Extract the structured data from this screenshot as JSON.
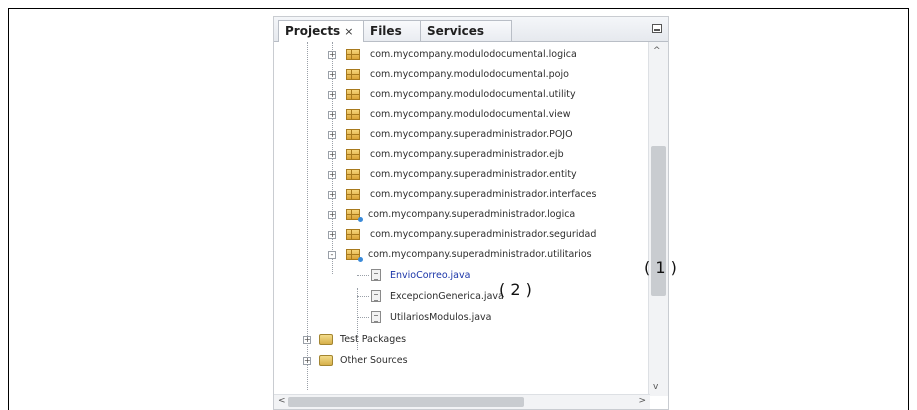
{
  "tabs": [
    {
      "label": "Projects",
      "close": "×",
      "active": true
    },
    {
      "label": "Files",
      "active": false
    },
    {
      "label": "Services",
      "active": false
    }
  ],
  "tree": {
    "packages": [
      "com.mycompany.modulodocumental.logica",
      "com.mycompany.modulodocumental.pojo",
      "com.mycompany.modulodocumental.utility",
      "com.mycompany.modulodocumental.view",
      "com.mycompany.superadministrador.POJO",
      "com.mycompany.superadministrador.ejb",
      "com.mycompany.superadministrador.entity",
      "com.mycompany.superadministrador.interfaces",
      "com.mycompany.superadministrador.logica",
      "com.mycompany.superadministrador.seguridad",
      "com.mycompany.superadministrador.utilitarios"
    ],
    "files": [
      "EnvioCorreo.java",
      "ExcepcionGenerica.java",
      "UtilariosModulos.java"
    ],
    "folders": [
      "Test Packages",
      "Other Sources"
    ]
  },
  "annotations": {
    "one": "( 1 )",
    "two": "( 2 )"
  },
  "scroll": {
    "up": "^",
    "down": "v",
    "left": "<",
    "right": ">"
  },
  "colors": {
    "link": "#1a35a8",
    "package": "#d9a336",
    "badge": "#3a8ad8"
  }
}
